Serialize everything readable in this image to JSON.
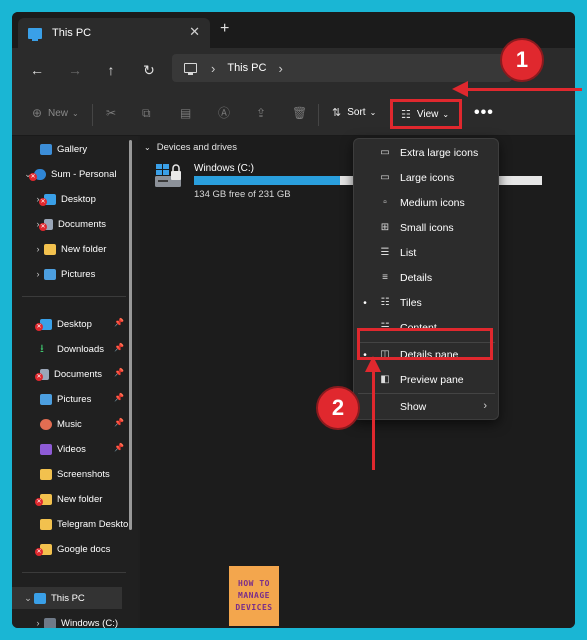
{
  "tab": {
    "title": "This PC",
    "close": "✕",
    "new": "+"
  },
  "address": {
    "location": "This PC"
  },
  "command": {
    "new_label": "New",
    "sort_label": "Sort",
    "view_label": "View",
    "more_label": "•••"
  },
  "badges": {
    "one": "1",
    "two": "2"
  },
  "sidebar": {
    "items": [
      {
        "label": "Gallery"
      },
      {
        "label": "Sum - Personal"
      },
      {
        "label": "Desktop"
      },
      {
        "label": "Documents"
      },
      {
        "label": "New folder"
      },
      {
        "label": "Pictures"
      },
      {
        "label": "Desktop"
      },
      {
        "label": "Downloads"
      },
      {
        "label": "Documents"
      },
      {
        "label": "Pictures"
      },
      {
        "label": "Music"
      },
      {
        "label": "Videos"
      },
      {
        "label": "Screenshots"
      },
      {
        "label": "New folder"
      },
      {
        "label": "Telegram Desktop"
      },
      {
        "label": "Google docs"
      },
      {
        "label": "This PC"
      },
      {
        "label": "Windows (C:)"
      }
    ]
  },
  "main": {
    "group_header": "Devices and drives",
    "drive": {
      "name": "Windows (C:)",
      "free_text": "134 GB free of 231 GB",
      "used_fraction": 0.42
    }
  },
  "view_menu": {
    "items": [
      {
        "label": "Extra large icons",
        "icon": "monitor-large-icon",
        "selected": false
      },
      {
        "label": "Large icons",
        "icon": "monitor-icon",
        "selected": false
      },
      {
        "label": "Medium icons",
        "icon": "monitor-small-icon",
        "selected": false
      },
      {
        "label": "Small icons",
        "icon": "grid-icon",
        "selected": false
      },
      {
        "label": "List",
        "icon": "list-icon",
        "selected": false
      },
      {
        "label": "Details",
        "icon": "details-icon",
        "selected": false
      },
      {
        "label": "Tiles",
        "icon": "tiles-icon",
        "selected": true
      },
      {
        "label": "Content",
        "icon": "content-icon",
        "selected": false
      },
      {
        "label": "Details pane",
        "icon": "details-pane-icon",
        "selected": true
      },
      {
        "label": "Preview pane",
        "icon": "preview-pane-icon",
        "selected": false
      },
      {
        "label": "Show",
        "icon": "",
        "selected": false
      }
    ]
  },
  "logo": {
    "line1": "HOW TO",
    "line2": "MANAGE",
    "line3": "DEVICES"
  },
  "colors": {
    "accent": "#e0282e",
    "drive_fill": "#2a9fdd",
    "background": "#1ab6d4"
  }
}
